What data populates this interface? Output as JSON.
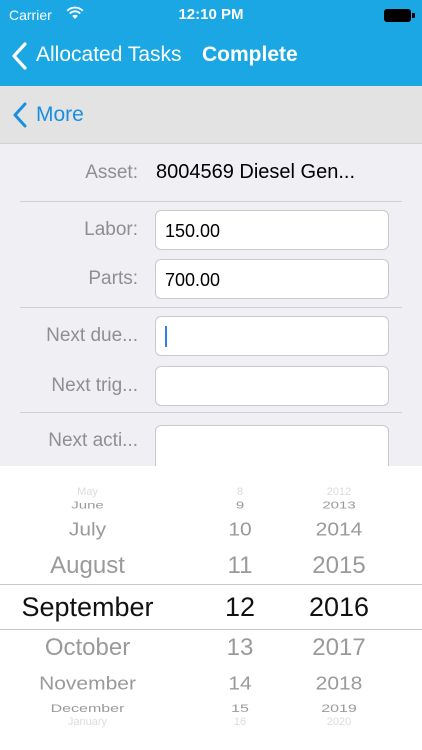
{
  "status_bar": {
    "carrier": "Carrier",
    "time": "12:10 PM"
  },
  "nav": {
    "back_label": "Allocated Tasks",
    "title": "Complete"
  },
  "subnav": {
    "back_label": "More"
  },
  "form": {
    "asset": {
      "label": "Asset:",
      "value": "8004569 Diesel Gen..."
    },
    "labor": {
      "label": "Labor:",
      "value": "150.00"
    },
    "parts": {
      "label": "Parts:",
      "value": "700.00"
    },
    "next_due": {
      "label": "Next due...",
      "value": ""
    },
    "next_trig": {
      "label": "Next trig...",
      "value": ""
    },
    "next_acti": {
      "label": "Next acti...",
      "value": ""
    }
  },
  "picker": {
    "months": [
      "May",
      "June",
      "July",
      "August",
      "September",
      "October",
      "November",
      "December",
      "January"
    ],
    "days": [
      "8",
      "9",
      "10",
      "11",
      "12",
      "13",
      "14",
      "15",
      "16"
    ],
    "years": [
      "2012",
      "2013",
      "2014",
      "2015",
      "2016",
      "2017",
      "2018",
      "2019",
      "2020"
    ],
    "selected": {
      "month": "September",
      "day": "12",
      "year": "2016"
    }
  },
  "colors": {
    "nav_bar": "#1aa7e4",
    "accent": "#1a8fe0",
    "caret": "#2f7ff3"
  }
}
